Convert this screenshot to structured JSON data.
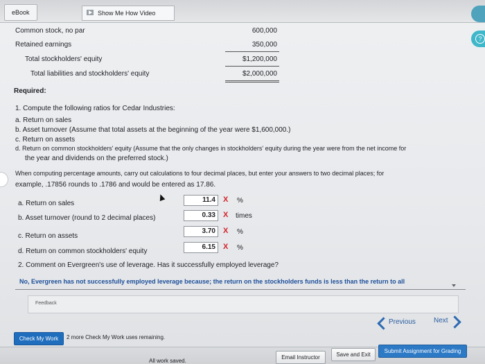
{
  "topbar": {
    "ebook_tab": "eBook",
    "video_button": "Show Me How Video"
  },
  "balance": {
    "rows": [
      {
        "label": "Common stock, no par",
        "value": "600,000"
      },
      {
        "label": "Retained earnings",
        "value": "350,000"
      },
      {
        "label": "Total stockholders' equity",
        "value": "$1,200,000"
      },
      {
        "label": "Total liabilities and stockholders' equity",
        "value": "$2,000,000"
      }
    ]
  },
  "required": {
    "heading": "Required:",
    "item1": "1.  Compute the following ratios for Cedar Industries:",
    "a": "a.  Return on sales",
    "b": "b.  Asset turnover (Assume that total assets at the beginning of the year were $1,600,000.)",
    "c": "c.  Return on assets",
    "d1": "d.  Return on common stockholders' equity (Assume that the only changes in stockholders' equity during the year were from the net income for",
    "d2": "the year and dividends on the preferred stock.)",
    "instr1": "When computing percentage amounts, carry out calculations to four decimal places, but enter your answers to two decimal places; for",
    "instr2": "example, .17856 rounds to .1786 and would be entered as 17.86."
  },
  "answers": [
    {
      "label": "a.  Return on sales",
      "value": "11.4",
      "mark": "X",
      "unit": "%"
    },
    {
      "label": "b.  Asset turnover (round to 2 decimal places)",
      "value": "0.33",
      "mark": "X",
      "unit": "times"
    },
    {
      "label": "c.  Return on assets",
      "value": "3.70",
      "mark": "X",
      "unit": "%"
    },
    {
      "label": "d.  Return on common stockholders' equity",
      "value": "6.15",
      "mark": "X",
      "unit": "%"
    }
  ],
  "question2": {
    "prompt": "2.  Comment on Evergreen's use of leverage. Has it successfully employed leverage?",
    "answer": "No, Evergreen has not successfully employed leverage because; the return on the stockholders funds is less than the return to all"
  },
  "feedback_label": "Feedback",
  "nav": {
    "previous": "Previous",
    "next": "Next"
  },
  "check": {
    "button": "Check My Work",
    "remaining": "2 more Check My Work uses remaining."
  },
  "footer": {
    "saved": "All work saved.",
    "email": "Email Instructor",
    "save_exit": "Save and Exit",
    "submit": "Submit Assignment for Grading"
  },
  "colors": {
    "error_mark": "#d2232a",
    "primary_button": "#1f6ebd",
    "nav_link": "#2a5da0"
  }
}
